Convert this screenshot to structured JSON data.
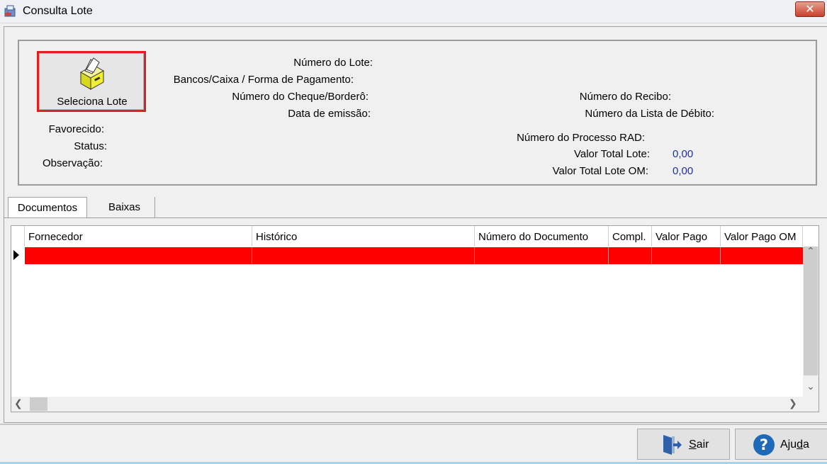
{
  "window": {
    "title": "Consulta Lote",
    "close_label": "✕"
  },
  "info": {
    "select_button": "Seleciona Lote",
    "numero_lote": "Número do Lote:",
    "bancos": "Bancos/Caixa / Forma de Pagamento:",
    "numero_cheque": "Número do Cheque/Borderô:",
    "data_emissao": "Data de emissão:",
    "favorecido": "Favorecido:",
    "status": "Status:",
    "observacao": "Observação:",
    "numero_recibo": "Número do Recibo:",
    "numero_lista_debito": "Número da Lista de Débito:",
    "numero_processo_rad": "Número do Processo RAD:",
    "valor_total_lote": "Valor Total Lote:",
    "valor_total_lote_value": "0,00",
    "valor_total_lote_om": "Valor Total Lote OM:",
    "valor_total_lote_om_value": "0,00"
  },
  "tabs": [
    {
      "label": "Documentos",
      "active": true
    },
    {
      "label": "Baixas",
      "active": false
    }
  ],
  "grid": {
    "columns": [
      "Fornecedor",
      "Histórico",
      "Número do Documento",
      "Compl.",
      "Valor Pago",
      "Valor Pago OM"
    ],
    "selected_row_color": "#ff0000"
  },
  "footer": {
    "sair": {
      "prefix": "",
      "accel": "S",
      "rest": "air"
    },
    "ajuda": {
      "prefix": "Aju",
      "accel": "d",
      "rest": "a"
    }
  },
  "colors": {
    "value_text": "#1f2fa0",
    "highlight_border": "#e02020"
  }
}
